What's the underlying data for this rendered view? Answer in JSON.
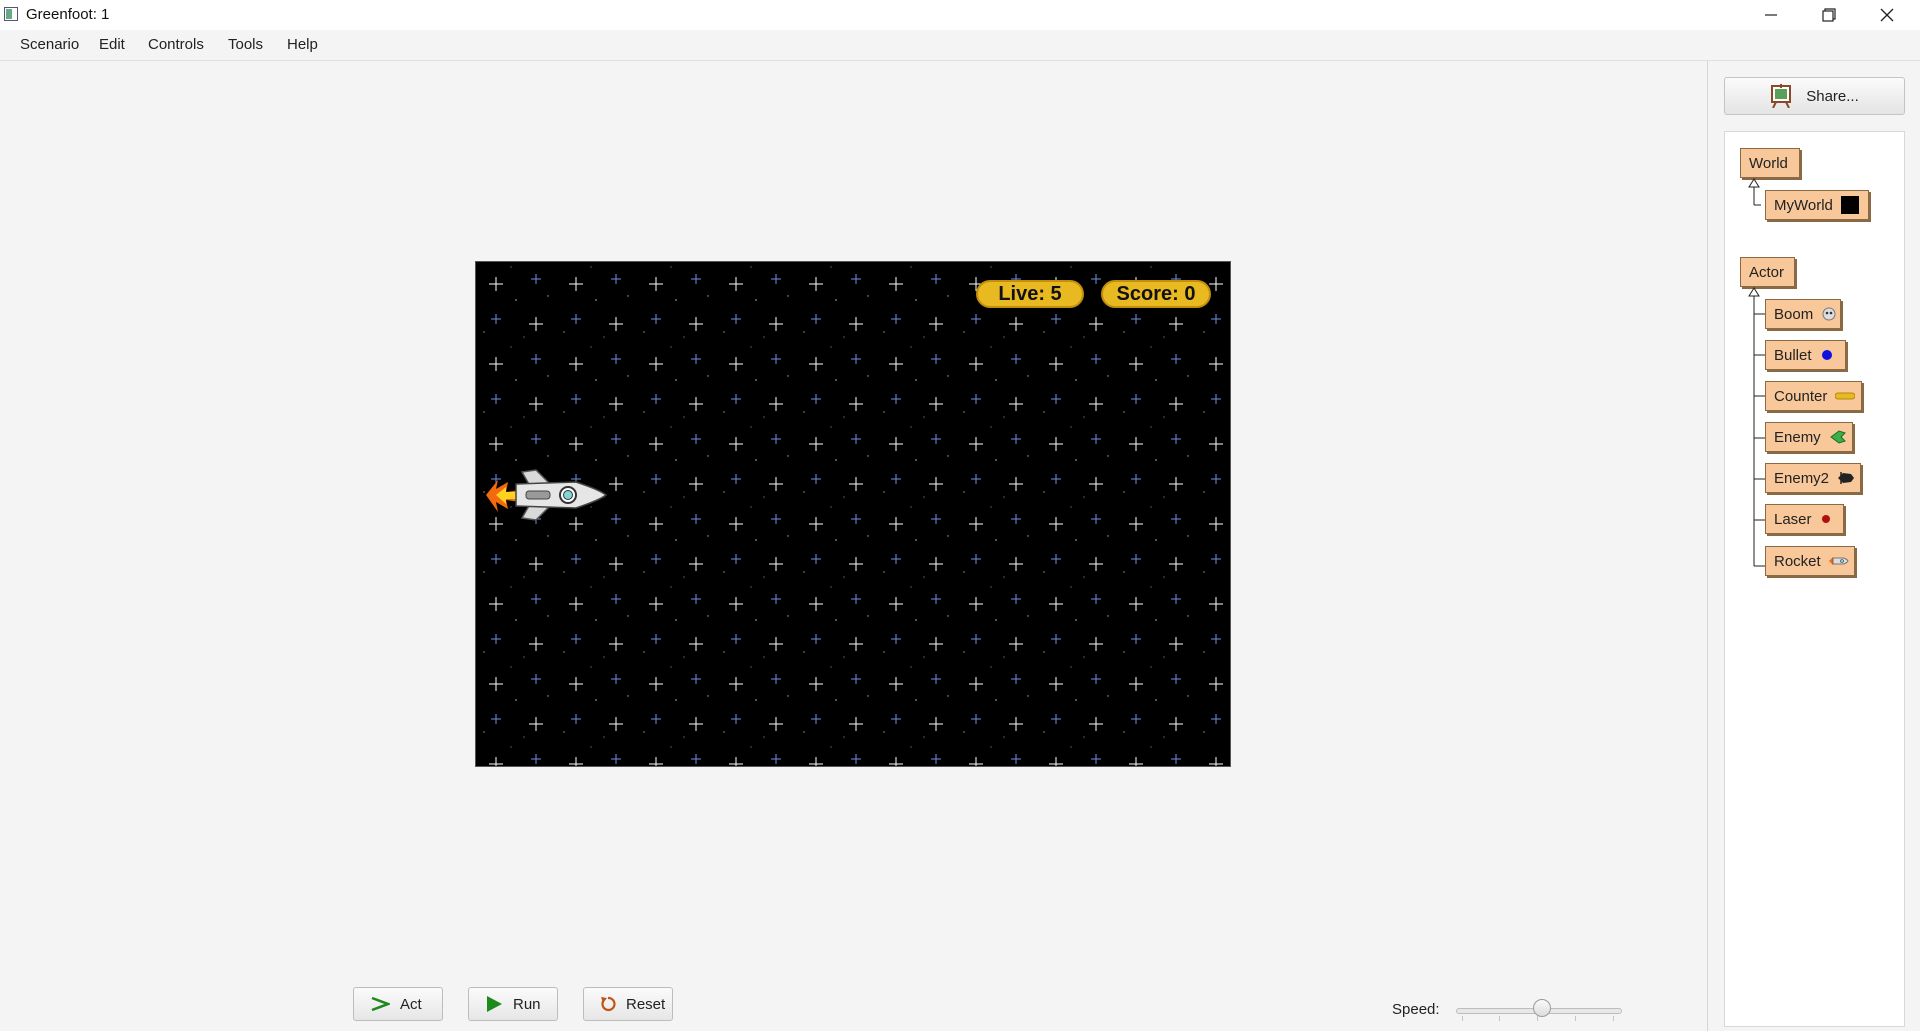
{
  "window": {
    "title": "Greenfoot: 1",
    "controls": {
      "minimize": "minimize-icon",
      "maximize": "maximize-icon",
      "close": "close-icon"
    }
  },
  "menu": [
    "Scenario",
    "Edit",
    "Controls",
    "Tools",
    "Help"
  ],
  "world": {
    "background": "starfield",
    "hud": {
      "lives": "Live: 5",
      "score": "Score: 0"
    },
    "actors": [
      "rocket"
    ]
  },
  "controls": {
    "act": "Act",
    "run": "Run",
    "reset": "Reset",
    "speed_label": "Speed:",
    "speed_value": 0.52
  },
  "share": {
    "label": "Share..."
  },
  "class_tree": {
    "world": {
      "label": "World",
      "subclasses": [
        {
          "label": "MyWorld",
          "icon": "black-square-icon"
        }
      ]
    },
    "actor": {
      "label": "Actor",
      "subclasses": [
        {
          "label": "Boom",
          "icon": "explosion-icon"
        },
        {
          "label": "Bullet",
          "icon": "blue-dot-icon"
        },
        {
          "label": "Counter",
          "icon": "yellow-bar-icon"
        },
        {
          "label": "Enemy",
          "icon": "green-ship-icon"
        },
        {
          "label": "Enemy2",
          "icon": "dark-ship-icon"
        },
        {
          "label": "Laser",
          "icon": "red-dot-icon"
        },
        {
          "label": "Rocket",
          "icon": "rocket-icon"
        }
      ]
    }
  },
  "colors": {
    "class_box": "#f8c89a",
    "hud": "#e8b921",
    "run_green": "#1e8a1e"
  }
}
